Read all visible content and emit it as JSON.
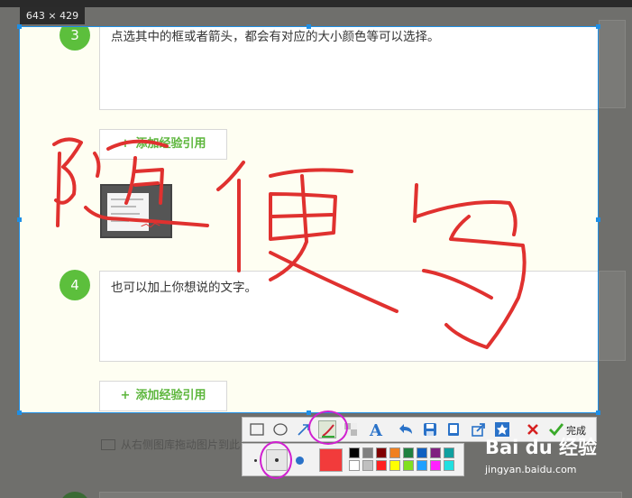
{
  "capture": {
    "size_label": "643 × 429"
  },
  "steps": [
    {
      "number": "3",
      "text": "点选其中的框或者箭头，都会有对应的大小颜色等可以选择。"
    },
    {
      "number": "4",
      "text": "也可以加上你想说的文字。"
    }
  ],
  "add_reference_label": "添加经验引用",
  "add_reference_plus": "+",
  "background_hint": "从右侧图库拖动图片到此",
  "annotation_text": "随便写",
  "toolbar": {
    "tools": [
      "rectangle-icon",
      "ellipse-icon",
      "arrow-icon",
      "brush-icon",
      "mosaic-icon",
      "text-icon",
      "undo-icon",
      "save-icon",
      "copy-icon",
      "share-icon",
      "pin-icon",
      "cancel-icon",
      "confirm-icon"
    ],
    "done_label": "完成"
  },
  "subbar": {
    "brush_sizes": [
      "small",
      "medium",
      "large"
    ],
    "selected_size": "medium",
    "current_color": "#f23b3b",
    "palette": [
      "#000000",
      "#808080",
      "#800000",
      "#f08020",
      "#208040",
      "#1060c0",
      "#802080",
      "#10a0a0",
      "#ffffff",
      "#c0c0c0",
      "#ff2020",
      "#ffff00",
      "#80e020",
      "#20a0ff",
      "#ff20ff",
      "#20e0e0"
    ]
  },
  "watermark": {
    "logo_text": "Bai du 经验",
    "url": "jingyan.baidu.com"
  },
  "colors": {
    "selection_border": "#1e8fe6",
    "step_green": "#5cbf3c",
    "annotation_red": "#e0312f",
    "highlight_ring": "#d020d0"
  }
}
